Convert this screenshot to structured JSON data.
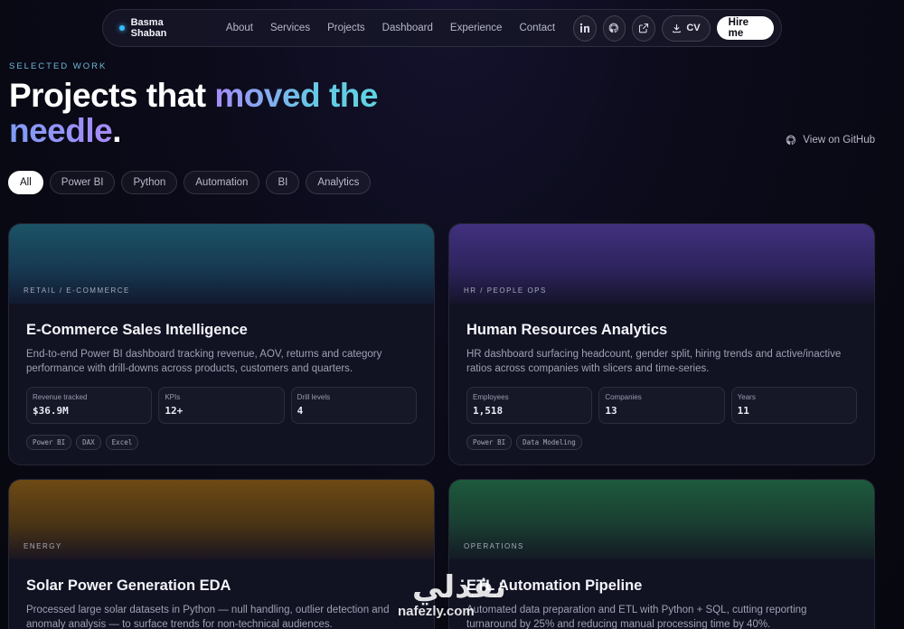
{
  "nav": {
    "brand": "Basma Shaban",
    "links": [
      "About",
      "Services",
      "Projects",
      "Dashboard",
      "Experience",
      "Contact"
    ],
    "icons": [
      "linkedin-icon",
      "github-icon",
      "external-link-icon"
    ],
    "cv_label": "CV",
    "hire_label": "Hire me"
  },
  "header": {
    "eyebrow": "SELECTED WORK",
    "title_part1": "Projects that ",
    "title_part2": "moved the",
    "title_part3": "needle",
    "title_part4": ".",
    "github_link": "View on GitHub"
  },
  "filters": [
    "All",
    "Power BI",
    "Python",
    "Automation",
    "BI",
    "Analytics"
  ],
  "cards": [
    {
      "category": "RETAIL / E-COMMERCE",
      "title": "E-Commerce Sales Intelligence",
      "description": "End-to-end Power BI dashboard tracking revenue, AOV, returns and category performance with drill-downs across products, customers and quarters.",
      "stats": [
        {
          "label": "Revenue tracked",
          "value": "$36.9M"
        },
        {
          "label": "KPIs",
          "value": "12+"
        },
        {
          "label": "Drill levels",
          "value": "4"
        }
      ],
      "tags": [
        "Power BI",
        "DAX",
        "Excel"
      ],
      "accent": "#1e5a6e"
    },
    {
      "category": "HR / PEOPLE OPS",
      "title": "Human Resources Analytics",
      "description": "HR dashboard surfacing headcount, gender split, hiring trends and active/inactive ratios across companies with slicers and time-series.",
      "stats": [
        {
          "label": "Employees",
          "value": "1,518"
        },
        {
          "label": "Companies",
          "value": "13"
        },
        {
          "label": "Years",
          "value": "11"
        }
      ],
      "tags": [
        "Power BI",
        "Data Modeling"
      ],
      "accent": "#4a2f8a"
    },
    {
      "category": "ENERGY",
      "title": "Solar Power Generation EDA",
      "description": "Processed large solar datasets in Python — null handling, outlier detection and anomaly analysis — to surface trends for non-technical audiences.",
      "accent": "#7a5418"
    },
    {
      "category": "OPERATIONS",
      "title": "ETL Automation Pipeline",
      "description": "Automated data preparation and ETL with Python + SQL, cutting reporting turnaround by 25% and reducing manual processing time by 40%.",
      "accent": "#1f5a3e"
    }
  ],
  "watermark": {
    "arabic": "نفذلي",
    "latin": "nafezly.com"
  }
}
